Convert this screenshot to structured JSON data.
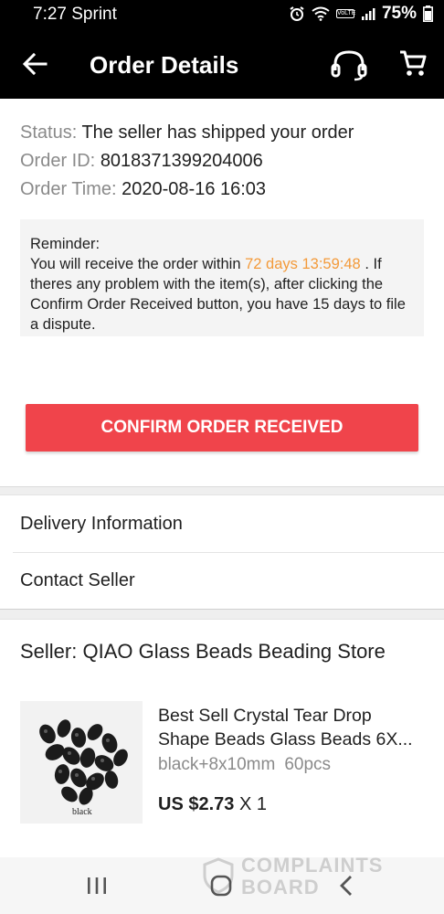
{
  "status_bar": {
    "time": "7:27 Sprint",
    "battery": "75%",
    "volte": "VoLTE"
  },
  "app_bar": {
    "title": "Order Details",
    "icons": [
      "back-arrow-icon",
      "headset-icon",
      "cart-icon"
    ]
  },
  "order": {
    "status_label": "Status:",
    "status_value": "The seller has shipped your order",
    "id_label": "Order ID:",
    "id_value": "8018371399204006",
    "time_label": "Order Time:",
    "time_value": "2020-08-16 16:03"
  },
  "reminder": {
    "heading": "Reminder:",
    "text_before": "You will receive the order within",
    "countdown": "72 days 13:59:48",
    "text_after": ". If theres any problem with the item(s), after clicking the Confirm Order Received button, you have 15 days to file a dispute."
  },
  "actions": {
    "confirm_label": "CONFIRM ORDER RECEIVED"
  },
  "links": {
    "delivery": "Delivery Information",
    "contact": "Contact Seller"
  },
  "seller": {
    "name": "Seller: QIAO Glass Beads Beading Store"
  },
  "product": {
    "image_caption": "black",
    "title": "Best Sell Crystal Tear Drop Shape Beads Glass Beads 6X...",
    "variant": "black+8x10mm",
    "quantity_desc": "60pcs",
    "price": "US $2.73",
    "multiplier": "X 1"
  },
  "watermark": {
    "line1": "COMPLAINTS",
    "line2": "BOARD"
  },
  "colors": {
    "confirm_button": "#f0444b",
    "countdown": "#f39a3a",
    "label_gray": "#8a8a8a",
    "app_bar": "#000000"
  }
}
